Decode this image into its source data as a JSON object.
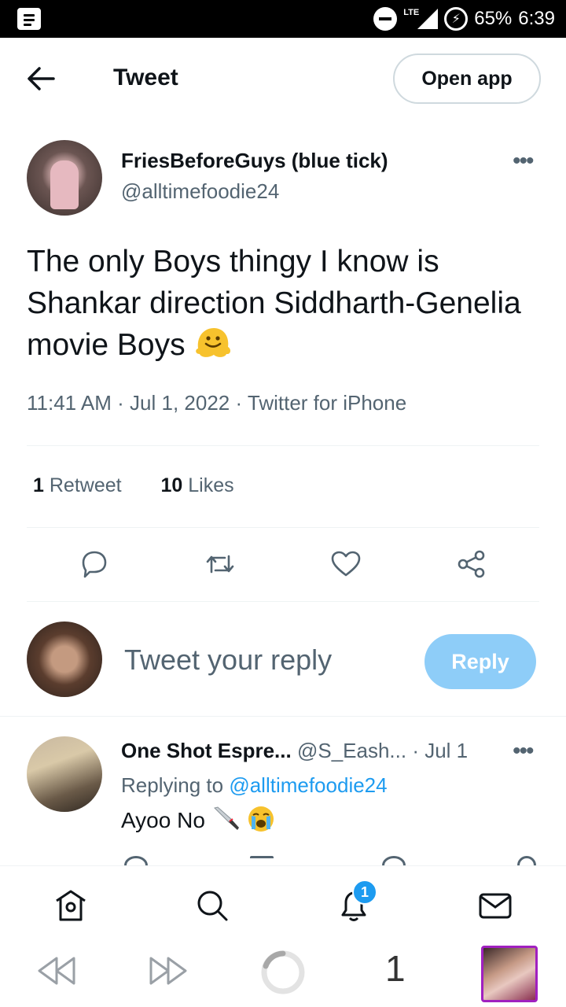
{
  "status_bar": {
    "network": "LTE",
    "battery_pct": "65%",
    "time": "6:39"
  },
  "header": {
    "title": "Tweet",
    "open_app_label": "Open app"
  },
  "tweet": {
    "author_name": "FriesBeforeGuys (blue tick)",
    "author_handle": "@alltimefoodie24",
    "text": "The only Boys thingy I know is Shankar direction Siddharth-Genelia movie Boys",
    "text_emoji": "melting-face",
    "timestamp": "11:41 AM · Jul 1, 2022 · Twitter for iPhone",
    "retweet_count": "1",
    "retweet_label": "Retweet",
    "like_count": "10",
    "like_label": "Likes",
    "more_label": "•••"
  },
  "actions": [
    "reply-icon",
    "retweet-icon",
    "like-icon",
    "share-icon"
  ],
  "compose": {
    "placeholder": "Tweet your reply",
    "reply_label": "Reply",
    "reply_button_color": "#8ecdf8"
  },
  "reply": {
    "author_name": "One Shot Espre...",
    "author_handle": "@S_Eash...",
    "date": "· Jul 1",
    "replying_prefix": "Replying to",
    "replying_handle": "@alltimefoodie24",
    "text": "Ayoo No",
    "text_emojis": [
      "knife",
      "loudly-crying-face"
    ],
    "more_label": "•••"
  },
  "bottom_nav": {
    "items": [
      "home-icon",
      "search-icon",
      "notifications-icon",
      "messages-icon"
    ],
    "notification_badge": "1"
  },
  "browser_bar": {
    "tab_count": "1"
  },
  "colors": {
    "accent": "#1d9bf0",
    "secondary_text": "#536471",
    "primary_text": "#0f1419"
  }
}
